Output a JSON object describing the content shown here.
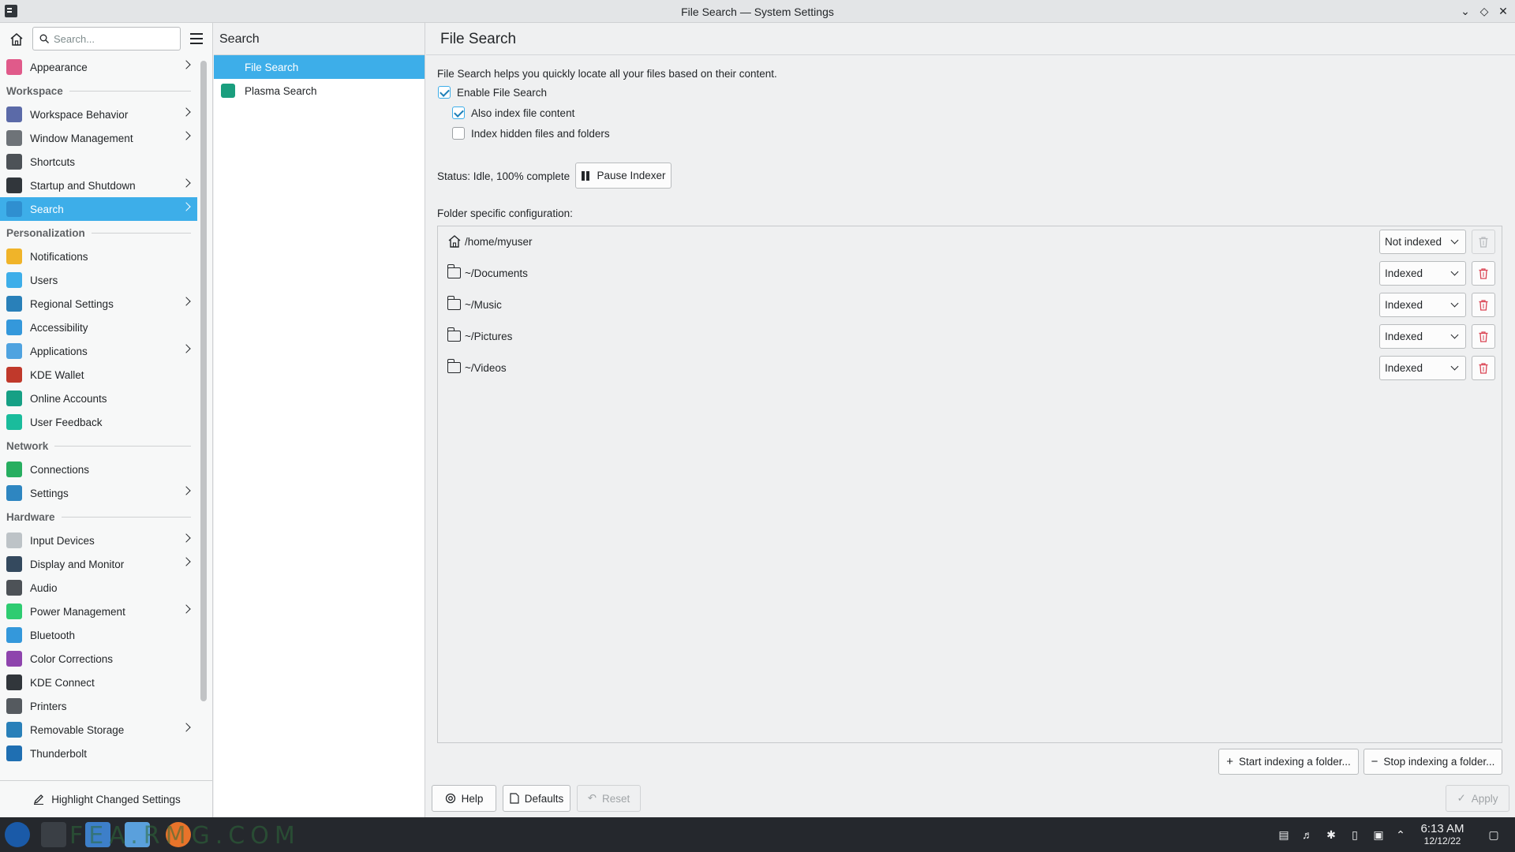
{
  "window": {
    "title": "File Search — System Settings"
  },
  "sidebar": {
    "search_placeholder": "Search...",
    "items": [
      {
        "type": "item",
        "label": "Appearance",
        "chevron": true,
        "color": "#e05a8a"
      },
      {
        "type": "section",
        "label": "Workspace"
      },
      {
        "type": "item",
        "label": "Workspace Behavior",
        "chevron": true,
        "color": "#5b6aa8"
      },
      {
        "type": "item",
        "label": "Window Management",
        "chevron": true,
        "color": "#6e7378"
      },
      {
        "type": "item",
        "label": "Shortcuts",
        "chevron": false,
        "color": "#4d5257"
      },
      {
        "type": "item",
        "label": "Startup and Shutdown",
        "chevron": true,
        "color": "#31363b"
      },
      {
        "type": "item",
        "label": "Search",
        "chevron": true,
        "color": "#2f8fd0",
        "active": true
      },
      {
        "type": "section",
        "label": "Personalization"
      },
      {
        "type": "item",
        "label": "Notifications",
        "chevron": false,
        "color": "#f0b429"
      },
      {
        "type": "item",
        "label": "Users",
        "chevron": false,
        "color": "#3daee9"
      },
      {
        "type": "item",
        "label": "Regional Settings",
        "chevron": true,
        "color": "#2980b9"
      },
      {
        "type": "item",
        "label": "Accessibility",
        "chevron": false,
        "color": "#3498db"
      },
      {
        "type": "item",
        "label": "Applications",
        "chevron": true,
        "color": "#4fa3e0"
      },
      {
        "type": "item",
        "label": "KDE Wallet",
        "chevron": false,
        "color": "#c0392b"
      },
      {
        "type": "item",
        "label": "Online Accounts",
        "chevron": false,
        "color": "#16a085"
      },
      {
        "type": "item",
        "label": "User Feedback",
        "chevron": false,
        "color": "#1abc9c"
      },
      {
        "type": "section",
        "label": "Network"
      },
      {
        "type": "item",
        "label": "Connections",
        "chevron": false,
        "color": "#27ae60"
      },
      {
        "type": "item",
        "label": "Settings",
        "chevron": true,
        "color": "#2e86c1"
      },
      {
        "type": "section",
        "label": "Hardware"
      },
      {
        "type": "item",
        "label": "Input Devices",
        "chevron": true,
        "color": "#bdc3c7"
      },
      {
        "type": "item",
        "label": "Display and Monitor",
        "chevron": true,
        "color": "#34495e"
      },
      {
        "type": "item",
        "label": "Audio",
        "chevron": false,
        "color": "#4d5257"
      },
      {
        "type": "item",
        "label": "Power Management",
        "chevron": true,
        "color": "#2ecc71"
      },
      {
        "type": "item",
        "label": "Bluetooth",
        "chevron": false,
        "color": "#3498db"
      },
      {
        "type": "item",
        "label": "Color Corrections",
        "chevron": false,
        "color": "#8e44ad"
      },
      {
        "type": "item",
        "label": "KDE Connect",
        "chevron": false,
        "color": "#31363b"
      },
      {
        "type": "item",
        "label": "Printers",
        "chevron": false,
        "color": "#555a5f"
      },
      {
        "type": "item",
        "label": "Removable Storage",
        "chevron": true,
        "color": "#2980b9"
      },
      {
        "type": "item",
        "label": "Thunderbolt",
        "chevron": false,
        "color": "#1f6fb2"
      }
    ],
    "highlight_label": "Highlight Changed Settings"
  },
  "subcol": {
    "header": "Search",
    "items": [
      {
        "label": "File Search",
        "active": true,
        "color": "#3daee9"
      },
      {
        "label": "Plasma Search",
        "active": false,
        "color": "#1a9e7e"
      }
    ]
  },
  "main": {
    "title": "File Search",
    "description": "File Search helps you quickly locate all your files based on their content.",
    "enable_label": "Enable File Search",
    "enable_checked": true,
    "content_label": "Also index file content",
    "content_checked": true,
    "hidden_label": "Index hidden files and folders",
    "hidden_checked": false,
    "status": "Status: Idle, 100% complete",
    "pause_label": "Pause Indexer",
    "folder_config_label": "Folder specific configuration:",
    "folders": [
      {
        "path": "/home/myuser",
        "state": "Not indexed",
        "icon": "home",
        "delete_enabled": false
      },
      {
        "path": "~/Documents",
        "state": "Indexed",
        "icon": "folder",
        "delete_enabled": true
      },
      {
        "path": "~/Music",
        "state": "Indexed",
        "icon": "folder",
        "delete_enabled": true
      },
      {
        "path": "~/Pictures",
        "state": "Indexed",
        "icon": "folder",
        "delete_enabled": true
      },
      {
        "path": "~/Videos",
        "state": "Indexed",
        "icon": "folder",
        "delete_enabled": true
      }
    ],
    "start_label": "Start indexing a folder...",
    "stop_label": "Stop indexing a folder...",
    "help_label": "Help",
    "defaults_label": "Defaults",
    "reset_label": "Reset",
    "apply_label": "Apply"
  },
  "taskbar": {
    "watermark": "FEA.RMG.COM",
    "time": "6:13 AM",
    "date": "12/12/22"
  },
  "colors": {
    "accent": "#3daee9",
    "danger": "#da4453"
  }
}
